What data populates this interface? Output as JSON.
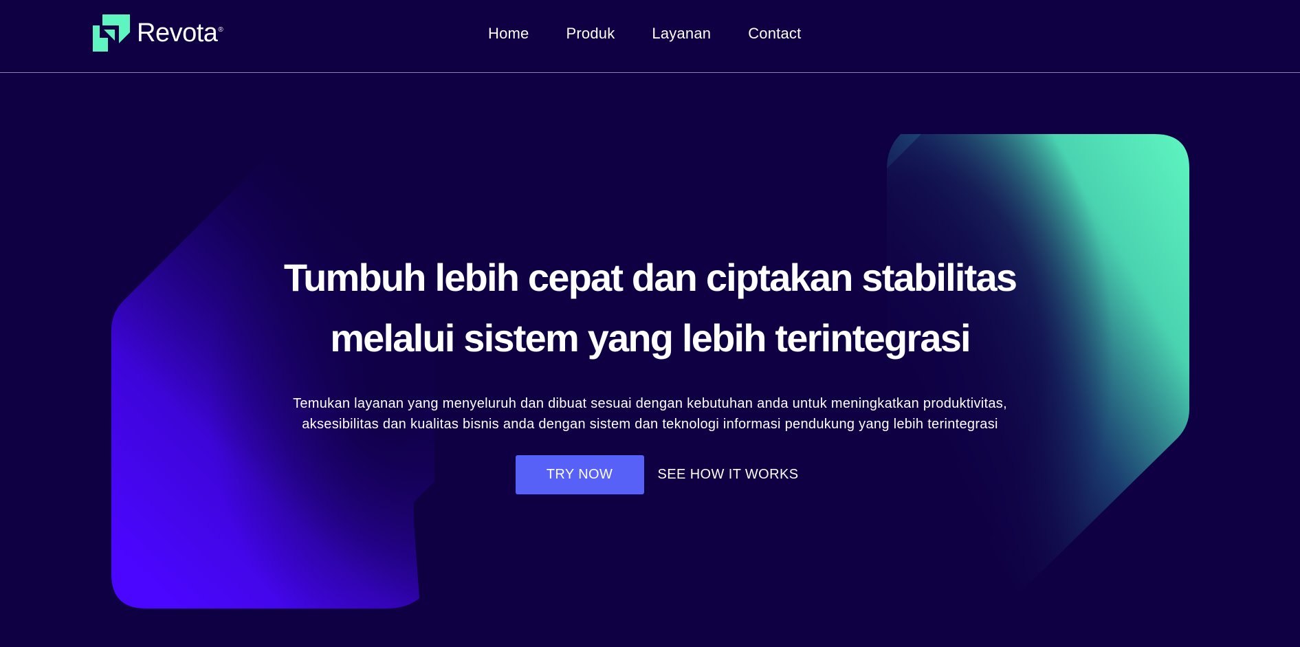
{
  "brand": {
    "name": "Revota",
    "trademark": "®",
    "logo_icon": "revota-arrow-logo-icon",
    "logo_color": "#5ff5c0"
  },
  "nav": {
    "items": [
      {
        "label": "Home"
      },
      {
        "label": "Produk"
      },
      {
        "label": "Layanan"
      },
      {
        "label": "Contact"
      }
    ]
  },
  "hero": {
    "title_lines": [
      "Tumbuh lebih cepat dan ciptakan stabilitas",
      "melalui sistem yang lebih terintegrasi"
    ],
    "subtitle_lines": [
      "Temukan layanan yang menyeluruh dan dibuat sesuai dengan kebutuhan anda untuk meningkatkan produktivitas,",
      "aksesibilitas dan kualitas bisnis anda dengan sistem dan teknologi informasi pendukung yang lebih terintegrasi"
    ],
    "primary_cta": "TRY NOW",
    "secondary_cta": "SEE HOW IT WORKS"
  },
  "colors": {
    "background": "#0f0044",
    "accent_button": "#5861f7",
    "shape_left": "#4b06ff",
    "shape_right": "#5ff5c0",
    "divider": "#8a84b3"
  }
}
